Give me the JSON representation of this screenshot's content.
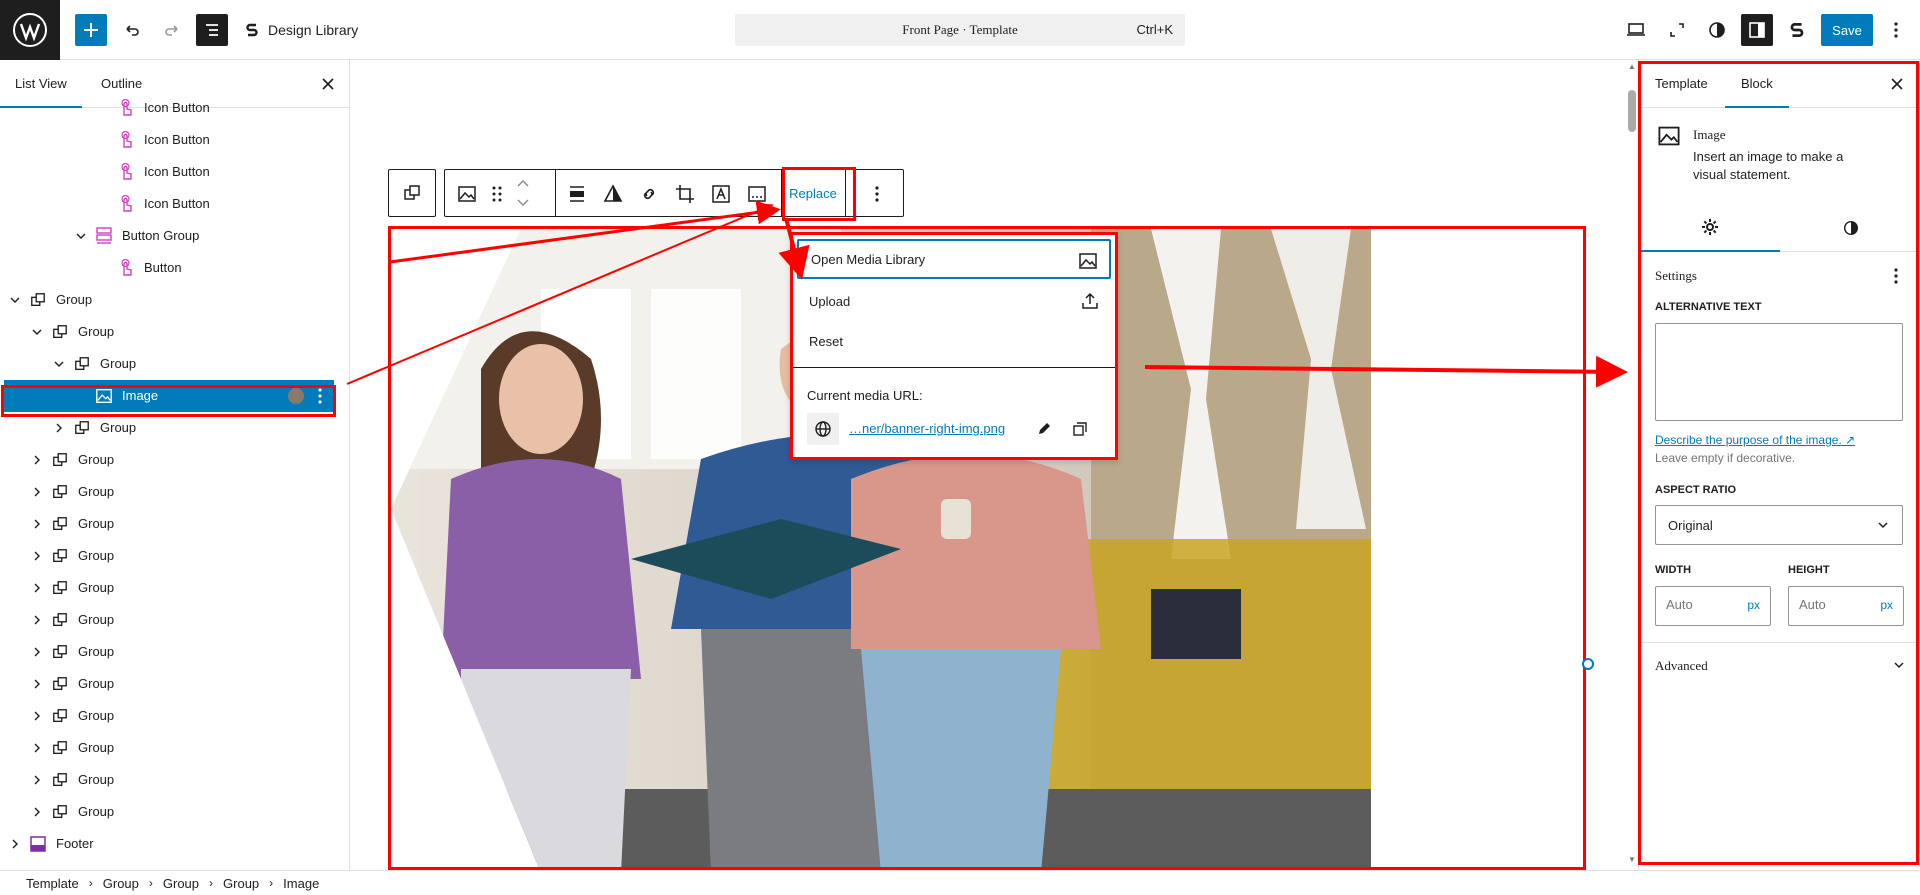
{
  "topbar": {
    "library_label": "Design Library",
    "command_title": "Front Page · Template",
    "command_shortcut": "Ctrl+K",
    "save_label": "Save",
    "icons": [
      "wordpress-icon",
      "plus-icon",
      "undo-icon",
      "redo-icon",
      "document-overview-icon",
      "desktop-icon",
      "fullscreen-icon",
      "styles-icon",
      "settings-icon",
      "spectra-icon",
      "more-vertical-icon"
    ]
  },
  "left_panel": {
    "tabs": [
      "List View",
      "Outline"
    ],
    "tree": [
      {
        "label": "Icon Button",
        "type": "icon-button"
      },
      {
        "label": "Icon Button",
        "type": "icon-button"
      },
      {
        "label": "Icon Button",
        "type": "icon-button"
      },
      {
        "label": "Icon Button",
        "type": "icon-button"
      },
      {
        "label": "Button Group",
        "type": "button-group"
      },
      {
        "label": "Button",
        "type": "icon-button"
      },
      {
        "label": "Group",
        "type": "group"
      },
      {
        "label": "Group",
        "type": "group"
      },
      {
        "label": "Group",
        "type": "group"
      },
      {
        "label": "Image",
        "type": "image"
      },
      {
        "label": "Group",
        "type": "group"
      },
      {
        "label": "Group",
        "type": "group"
      },
      {
        "label": "Group",
        "type": "group"
      },
      {
        "label": "Group",
        "type": "group"
      },
      {
        "label": "Group",
        "type": "group"
      },
      {
        "label": "Group",
        "type": "group"
      },
      {
        "label": "Group",
        "type": "group"
      },
      {
        "label": "Group",
        "type": "group"
      },
      {
        "label": "Group",
        "type": "group"
      },
      {
        "label": "Group",
        "type": "group"
      },
      {
        "label": "Group",
        "type": "group"
      },
      {
        "label": "Group",
        "type": "group"
      },
      {
        "label": "Group",
        "type": "group"
      },
      {
        "label": "Footer",
        "type": "footer"
      }
    ]
  },
  "breadcrumb": [
    "Template",
    "Group",
    "Group",
    "Group",
    "Image"
  ],
  "block_toolbar": {
    "replace_label": "Replace"
  },
  "replace_menu": {
    "items": [
      "Open Media Library",
      "Upload",
      "Reset"
    ],
    "current_url_label": "Current media URL:",
    "current_url": "…ner/banner-right-img.png"
  },
  "right_panel": {
    "tabs": [
      "Template",
      "Block"
    ],
    "block_title": "Image",
    "block_description": "Insert an image to make a visual statement.",
    "settings_label": "Settings",
    "alt_text_label": "ALTERNATIVE TEXT",
    "alt_text_value": "",
    "alt_link": "Describe the purpose of the image. ↗",
    "alt_help": "Leave empty if decorative.",
    "aspect_label": "ASPECT RATIO",
    "aspect_value": "Original",
    "width_label": "WIDTH",
    "height_label": "HEIGHT",
    "width_placeholder": "Auto",
    "height_placeholder": "Auto",
    "unit": "px",
    "advanced_label": "Advanced"
  },
  "colors": {
    "accent": "#007cba",
    "annotation": "#ff0000",
    "dark": "#1e1e1e"
  }
}
